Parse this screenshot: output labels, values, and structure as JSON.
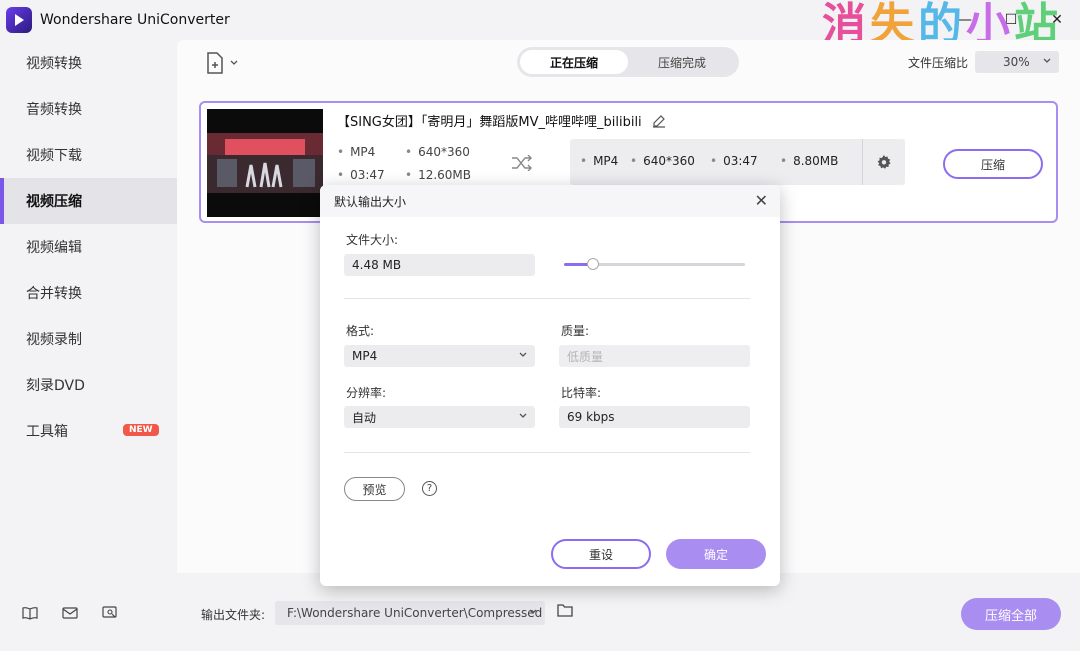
{
  "app": {
    "title": "Wondershare UniConverter",
    "watermark": [
      "消",
      "失",
      "的",
      "小",
      "站"
    ]
  },
  "window_controls": {
    "minimize": "—",
    "maximize": "☐",
    "close": "✕"
  },
  "sidebar": {
    "items": [
      {
        "label": "视频转换",
        "active": false
      },
      {
        "label": "音频转换",
        "active": false
      },
      {
        "label": "视频下载",
        "active": false
      },
      {
        "label": "视频压缩",
        "active": true
      },
      {
        "label": "视频编辑",
        "active": false
      },
      {
        "label": "合并转换",
        "active": false
      },
      {
        "label": "视频录制",
        "active": false
      },
      {
        "label": "刻录DVD",
        "active": false
      },
      {
        "label": "工具箱",
        "active": false,
        "badge": "NEW"
      }
    ]
  },
  "toolbar": {
    "tabs": [
      {
        "label": "正在压缩",
        "active": true
      },
      {
        "label": "压缩完成",
        "active": false
      }
    ],
    "ratio_label": "文件压缩比",
    "ratio_value": "30%"
  },
  "file_card": {
    "title": "【SING女团】「寄明月」舞蹈版MV_哔哩哔哩_bilibili",
    "source": {
      "format": "MP4",
      "resolution": "640*360",
      "duration": "03:47",
      "size": "12.60MB"
    },
    "target": {
      "format": "MP4",
      "resolution": "640*360",
      "duration": "03:47",
      "size": "8.80MB"
    },
    "compress_label": "压缩"
  },
  "dialog": {
    "title": "默认输出大小",
    "size_label": "文件大小:",
    "size_value": "4.48 MB",
    "size_slider_fraction": 0.16,
    "format_label": "格式:",
    "format_value": "MP4",
    "quality_label": "质量:",
    "quality_value": "低质量",
    "resolution_label": "分辨率:",
    "resolution_value": "自动",
    "bitrate_label": "比特率:",
    "bitrate_value": "69 kbps",
    "preview_label": "预览",
    "help": "?",
    "reset_label": "重设",
    "ok_label": "确定"
  },
  "bottom": {
    "output_label": "输出文件夹:",
    "output_path": "F:\\Wondershare UniConverter\\Compressed",
    "compress_all_label": "压缩全部"
  },
  "colors": {
    "accent": "#8c6cf0",
    "accent_light": "#a98df0",
    "badge": "#f0594a"
  }
}
